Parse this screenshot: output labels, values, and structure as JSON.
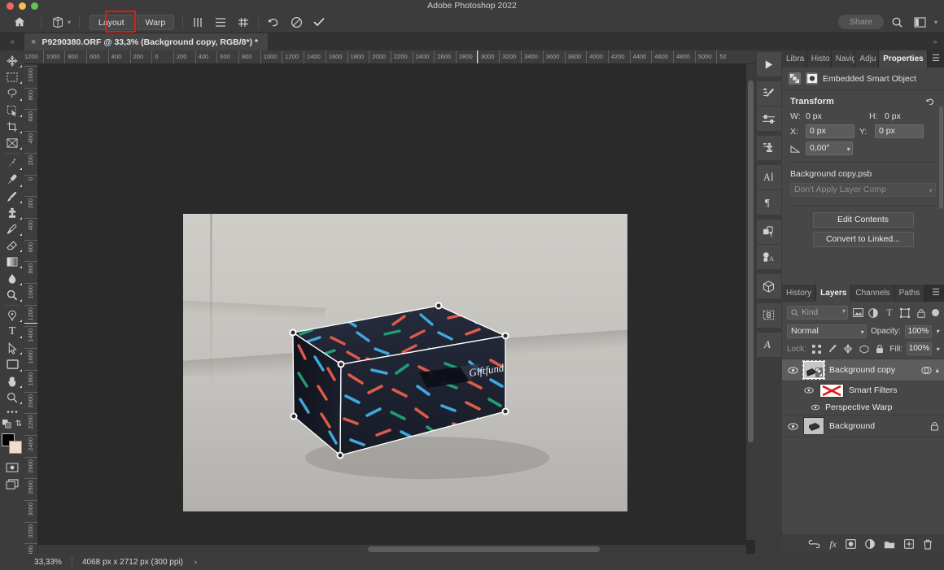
{
  "window": {
    "title": "Adobe Photoshop 2022",
    "traffic_lights": [
      "close",
      "minimize",
      "zoom"
    ]
  },
  "options_bar": {
    "home_icon": "home-icon",
    "tool_icon": "perspective-warp-icon",
    "buttons": [
      {
        "label": "Layout",
        "active": false
      },
      {
        "label": "Warp",
        "active": true,
        "highlighted": true
      }
    ],
    "icons": [
      "vertical-lines-icon",
      "horizontal-lines-icon",
      "grid-icon",
      "undo-icon",
      "cancel-icon",
      "commit-icon"
    ],
    "share_label": "Share",
    "right_icons": [
      "search-icon",
      "workspace-icon",
      "chevron-down-icon"
    ]
  },
  "document_tab": {
    "close": "×",
    "title": "P9290380.ORF @ 33,3% (Background copy, RGB/8*) *"
  },
  "toolbar": {
    "tools": [
      {
        "name": "move-tool",
        "glyph": "move"
      },
      {
        "name": "rectangular-marquee-tool",
        "glyph": "marquee"
      },
      {
        "name": "lasso-tool",
        "glyph": "lasso"
      },
      {
        "name": "object-selection-tool",
        "glyph": "objsel"
      },
      {
        "name": "crop-tool",
        "glyph": "crop"
      },
      {
        "name": "frame-tool",
        "glyph": "frame"
      },
      {
        "name": "eyedropper-tool",
        "glyph": "eyedropper"
      },
      {
        "name": "healing-brush-tool",
        "glyph": "heal"
      },
      {
        "name": "brush-tool",
        "glyph": "brush"
      },
      {
        "name": "clone-stamp-tool",
        "glyph": "stamp"
      },
      {
        "name": "history-brush-tool",
        "glyph": "historybrush"
      },
      {
        "name": "eraser-tool",
        "glyph": "eraser"
      },
      {
        "name": "gradient-tool",
        "glyph": "gradient"
      },
      {
        "name": "blur-tool",
        "glyph": "blur"
      },
      {
        "name": "dodge-tool",
        "glyph": "dodge"
      },
      {
        "name": "pen-tool",
        "glyph": "pen"
      },
      {
        "name": "type-tool",
        "glyph": "type"
      },
      {
        "name": "path-selection-tool",
        "glyph": "pathsel"
      },
      {
        "name": "rectangle-tool",
        "glyph": "rect"
      },
      {
        "name": "hand-tool",
        "glyph": "hand"
      },
      {
        "name": "zoom-tool",
        "glyph": "zoom"
      },
      {
        "name": "edit-toolbar-tool",
        "glyph": "ellipsis"
      }
    ],
    "foreground_color": "#000000",
    "background_color": "#f2dcc4",
    "bottom_icons": [
      "quick-mask-icon",
      "screen-mode-icon"
    ]
  },
  "rulers": {
    "unit": "px",
    "horizontal_ticks": [
      "1200",
      "1000",
      "800",
      "600",
      "400",
      "200",
      "0",
      "200",
      "400",
      "600",
      "800",
      "1000",
      "1200",
      "1400",
      "1600",
      "1800",
      "2000",
      "2200",
      "2400",
      "2600",
      "2800",
      "3000",
      "3200",
      "3400",
      "3600",
      "3800",
      "4000",
      "4200",
      "4400",
      "4600",
      "4800",
      "5000",
      "52"
    ],
    "vertical_ticks": [
      "1000",
      "800",
      "600",
      "400",
      "200",
      "0",
      "200",
      "400",
      "600",
      "800",
      "1000",
      "1200",
      "1400",
      "1600",
      "1800",
      "2000",
      "2200",
      "2400",
      "2600",
      "2800",
      "3000",
      "3200",
      "3400"
    ]
  },
  "dock": {
    "items": [
      "play-icon",
      "adjustments-brush-icon",
      "adjustments-sliders-icon",
      "styles-icon",
      "character-icon",
      "paragraph-icon",
      "layer-comps-icon",
      "glyphs-icon",
      "3d-icon",
      "patterns-icon",
      "type-styles-icon"
    ]
  },
  "properties_panel": {
    "tabs": [
      "Libra",
      "Histo",
      "Navig",
      "Adju",
      "Properties"
    ],
    "active_tab": "Properties",
    "object_type": "Embedded Smart Object",
    "transform": {
      "title": "Transform",
      "reset_icon": "reset-icon",
      "w_label": "W:",
      "w_value": "0 px",
      "h_label": "H:",
      "h_value": "0 px",
      "x_label": "X:",
      "x_value": "0 px",
      "y_label": "Y:",
      "y_value": "0 px",
      "angle_icon": "angle-icon",
      "angle_value": "0,00°"
    },
    "psb_name": "Background copy.psb",
    "layer_comp": "Don't Apply Layer Comp",
    "edit_contents_label": "Edit Contents",
    "convert_linked_label": "Convert to Linked..."
  },
  "layers_panel": {
    "tabs": [
      "History",
      "Layers",
      "Channels",
      "Paths"
    ],
    "active_tab": "Layers",
    "menu_icon": "panel-menu-icon",
    "filter": {
      "search_icon": "search-icon",
      "kind_label": "Kind",
      "filter_icons": [
        "pixel-filter-icon",
        "adjustment-filter-icon",
        "type-filter-icon",
        "shape-filter-icon",
        "smart-object-filter-icon"
      ],
      "toggle": "filter-toggle"
    },
    "blend_mode": "Normal",
    "opacity_label": "Opacity:",
    "opacity_value": "100%",
    "lock_label": "Lock:",
    "lock_icons": [
      "lock-transparent-icon",
      "lock-image-icon",
      "lock-position-icon",
      "lock-artboard-icon",
      "lock-all-icon"
    ],
    "fill_label": "Fill:",
    "fill_value": "100%",
    "layers": [
      {
        "name": "Background copy",
        "selected": true,
        "visible": true,
        "thumbnail": "smart-object-thumbnail",
        "right_icons": [
          "smart-filter-icon",
          "chevron-up-icon"
        ],
        "children": [
          {
            "name": "Smart Filters",
            "visible": true,
            "thumbnail": "filter-mask-thumbnail"
          },
          {
            "name": "Perspective Warp",
            "visible": true,
            "thumbnail": "none"
          }
        ]
      },
      {
        "name": "Background",
        "selected": false,
        "visible": true,
        "thumbnail": "photo-thumbnail",
        "locked": true,
        "right_icons": [
          "lock-icon"
        ]
      }
    ],
    "bottom_icons": [
      "link-layers-icon",
      "fx-icon",
      "add-mask-icon",
      "adjustment-layer-icon",
      "new-group-icon",
      "new-layer-icon",
      "delete-layer-icon"
    ]
  },
  "status_bar": {
    "zoom": "33,33%",
    "doc_info": "4068 px x 2712 px (300 ppi)",
    "expand_arrow": "›"
  },
  "colors": {
    "highlight_red": "#e01b1b",
    "panel_bg": "#474747",
    "chrome_bg": "#3c3c3c",
    "canvas_bg": "#2a2a2a",
    "warp_handle": "#ffffff"
  },
  "canvas": {
    "photo_alt": "gift-box-with-colored-sprinkles-pattern",
    "brand_script": "Giftfund",
    "warp_handles": 7
  }
}
